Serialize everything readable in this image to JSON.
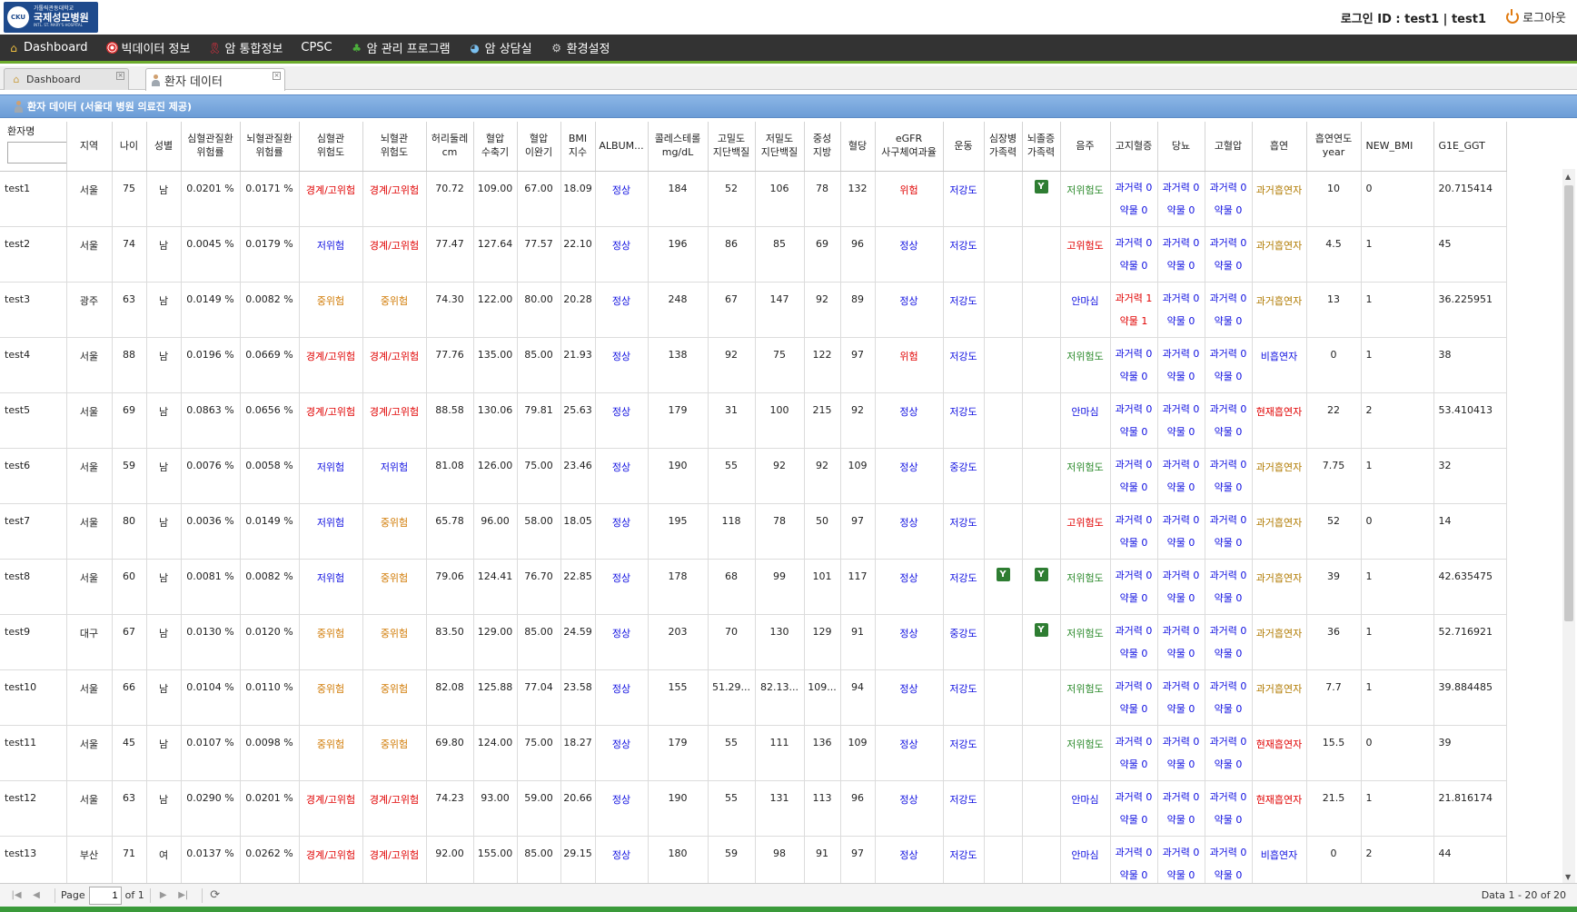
{
  "header": {
    "logo_sub": "가톨릭관동대학교",
    "logo_main": "국제성모병원",
    "logo_en": "INTL. ST. MARY'S HOSPITAL",
    "logo_emblem": "CKU",
    "login_text": "로그인 ID : test1 | test1",
    "logout_label": "로그아웃"
  },
  "menu": [
    {
      "label": "Dashboard",
      "icon": "home-icon"
    },
    {
      "label": "빅데이터 정보",
      "icon": "target-icon"
    },
    {
      "label": "암 통합정보",
      "icon": "ribbon-icon"
    },
    {
      "label": "CPSC",
      "icon": ""
    },
    {
      "label": "암 관리 프로그램",
      "icon": "plant-icon"
    },
    {
      "label": "암 상담실",
      "icon": "chat-icon"
    },
    {
      "label": "환경설정",
      "icon": "gear-icon"
    }
  ],
  "tabs": [
    {
      "label": "Dashboard"
    },
    {
      "label": "환자 데이터"
    }
  ],
  "panel_title": "환자 데이터 (서울대 병원 의료진 제공)",
  "colors": {
    "accent_green": "#6cab2c",
    "header_blue": "#6b9cd6",
    "red": "#e00000",
    "blue": "#1010e0",
    "orange": "#d07800",
    "green": "#2b8a2b"
  },
  "columns": [
    "환자명",
    "지역",
    "나이",
    "성별",
    "심혈관질환\n위험률",
    "뇌혈관질환\n위험률",
    "심혈관\n위험도",
    "뇌혈관\n위험도",
    "허리둘레\ncm",
    "혈압\n수축기",
    "혈압\n이완기",
    "BMI\n지수",
    "ALBUM...",
    "콜레스테롤\nmg/dL",
    "고밀도\n지단백질",
    "저밀도\n지단백질",
    "중성\n지방",
    "혈당",
    "eGFR\n사구체여과율",
    "운동",
    "심장병\n가족력",
    "뇌졸증\n가족력",
    "음주",
    "고지혈증",
    "당뇨",
    "고혈압",
    "흡연",
    "흡연연도\nyear",
    "NEW_BMI",
    "G1E_GGT"
  ],
  "rows": [
    {
      "name": "test1",
      "region": "서울",
      "age": "75",
      "sex": "남",
      "cvd": "0.0201 %",
      "cbd": "0.0171 %",
      "cvd_lvl": "경계/고위험",
      "cbd_lvl": "경계/고위험",
      "waist": "70.72",
      "sbp": "109.00",
      "dbp": "67.00",
      "bmi": "18.09",
      "album": "정상",
      "chol": "184",
      "hdl": "52",
      "ldl": "106",
      "tg": "78",
      "glu": "132",
      "egfr": "위험",
      "ex": "저강도",
      "heart_fh": "",
      "stroke_fh": "Y",
      "alc": "저위험도",
      "lip1": "과거력 0",
      "lip2": "약물 0",
      "dm1": "과거력 0",
      "dm2": "약물 0",
      "ht1": "과거력 0",
      "ht2": "약물 0",
      "smk": "과거흡연자",
      "smk_yr": "10",
      "new_bmi": "0",
      "ggt": "20.715414"
    },
    {
      "name": "test2",
      "region": "서울",
      "age": "74",
      "sex": "남",
      "cvd": "0.0045 %",
      "cbd": "0.0179 %",
      "cvd_lvl": "저위험",
      "cbd_lvl": "경계/고위험",
      "waist": "77.47",
      "sbp": "127.64",
      "dbp": "77.57",
      "bmi": "22.10",
      "album": "정상",
      "chol": "196",
      "hdl": "86",
      "ldl": "85",
      "tg": "69",
      "glu": "96",
      "egfr": "정상",
      "ex": "저강도",
      "heart_fh": "",
      "stroke_fh": "",
      "alc": "고위험도",
      "lip1": "과거력 0",
      "lip2": "약물 0",
      "dm1": "과거력 0",
      "dm2": "약물 0",
      "ht1": "과거력 0",
      "ht2": "약물 0",
      "smk": "과거흡연자",
      "smk_yr": "4.5",
      "new_bmi": "1",
      "ggt": "45"
    },
    {
      "name": "test3",
      "region": "광주",
      "age": "63",
      "sex": "남",
      "cvd": "0.0149 %",
      "cbd": "0.0082 %",
      "cvd_lvl": "중위험",
      "cbd_lvl": "중위험",
      "waist": "74.30",
      "sbp": "122.00",
      "dbp": "80.00",
      "bmi": "20.28",
      "album": "정상",
      "chol": "248",
      "hdl": "67",
      "ldl": "147",
      "tg": "92",
      "glu": "89",
      "egfr": "정상",
      "ex": "저강도",
      "heart_fh": "",
      "stroke_fh": "",
      "alc": "안마심",
      "lip1": "과거력 1",
      "lip2": "약물 1",
      "dm1": "과거력 0",
      "dm2": "약물 0",
      "ht1": "과거력 0",
      "ht2": "약물 0",
      "smk": "과거흡연자",
      "smk_yr": "13",
      "new_bmi": "1",
      "ggt": "36.225951"
    },
    {
      "name": "test4",
      "region": "서울",
      "age": "88",
      "sex": "남",
      "cvd": "0.0196 %",
      "cbd": "0.0669 %",
      "cvd_lvl": "경계/고위험",
      "cbd_lvl": "경계/고위험",
      "waist": "77.76",
      "sbp": "135.00",
      "dbp": "85.00",
      "bmi": "21.93",
      "album": "정상",
      "chol": "138",
      "hdl": "92",
      "ldl": "75",
      "tg": "122",
      "glu": "97",
      "egfr": "위험",
      "ex": "저강도",
      "heart_fh": "",
      "stroke_fh": "",
      "alc": "저위험도",
      "lip1": "과거력 0",
      "lip2": "약물 0",
      "dm1": "과거력 0",
      "dm2": "약물 0",
      "ht1": "과거력 0",
      "ht2": "약물 0",
      "smk": "비흡연자",
      "smk_yr": "0",
      "new_bmi": "1",
      "ggt": "38"
    },
    {
      "name": "test5",
      "region": "서울",
      "age": "69",
      "sex": "남",
      "cvd": "0.0863 %",
      "cbd": "0.0656 %",
      "cvd_lvl": "경계/고위험",
      "cbd_lvl": "경계/고위험",
      "waist": "88.58",
      "sbp": "130.06",
      "dbp": "79.81",
      "bmi": "25.63",
      "album": "정상",
      "chol": "179",
      "hdl": "31",
      "ldl": "100",
      "tg": "215",
      "glu": "92",
      "egfr": "정상",
      "ex": "저강도",
      "heart_fh": "",
      "stroke_fh": "",
      "alc": "안마심",
      "lip1": "과거력 0",
      "lip2": "약물 0",
      "dm1": "과거력 0",
      "dm2": "약물 0",
      "ht1": "과거력 0",
      "ht2": "약물 0",
      "smk": "현재흡연자",
      "smk_yr": "22",
      "new_bmi": "2",
      "ggt": "53.410413"
    },
    {
      "name": "test6",
      "region": "서울",
      "age": "59",
      "sex": "남",
      "cvd": "0.0076 %",
      "cbd": "0.0058 %",
      "cvd_lvl": "저위험",
      "cbd_lvl": "저위험",
      "waist": "81.08",
      "sbp": "126.00",
      "dbp": "75.00",
      "bmi": "23.46",
      "album": "정상",
      "chol": "190",
      "hdl": "55",
      "ldl": "92",
      "tg": "92",
      "glu": "109",
      "egfr": "정상",
      "ex": "중강도",
      "heart_fh": "",
      "stroke_fh": "",
      "alc": "저위험도",
      "lip1": "과거력 0",
      "lip2": "약물 0",
      "dm1": "과거력 0",
      "dm2": "약물 0",
      "ht1": "과거력 0",
      "ht2": "약물 0",
      "smk": "과거흡연자",
      "smk_yr": "7.75",
      "new_bmi": "1",
      "ggt": "32"
    },
    {
      "name": "test7",
      "region": "서울",
      "age": "80",
      "sex": "남",
      "cvd": "0.0036 %",
      "cbd": "0.0149 %",
      "cvd_lvl": "저위험",
      "cbd_lvl": "중위험",
      "waist": "65.78",
      "sbp": "96.00",
      "dbp": "58.00",
      "bmi": "18.05",
      "album": "정상",
      "chol": "195",
      "hdl": "118",
      "ldl": "78",
      "tg": "50",
      "glu": "97",
      "egfr": "정상",
      "ex": "저강도",
      "heart_fh": "",
      "stroke_fh": "",
      "alc": "고위험도",
      "lip1": "과거력 0",
      "lip2": "약물 0",
      "dm1": "과거력 0",
      "dm2": "약물 0",
      "ht1": "과거력 0",
      "ht2": "약물 0",
      "smk": "과거흡연자",
      "smk_yr": "52",
      "new_bmi": "0",
      "ggt": "14"
    },
    {
      "name": "test8",
      "region": "서울",
      "age": "60",
      "sex": "남",
      "cvd": "0.0081 %",
      "cbd": "0.0082 %",
      "cvd_lvl": "저위험",
      "cbd_lvl": "중위험",
      "waist": "79.06",
      "sbp": "124.41",
      "dbp": "76.70",
      "bmi": "22.85",
      "album": "정상",
      "chol": "178",
      "hdl": "68",
      "ldl": "99",
      "tg": "101",
      "glu": "117",
      "egfr": "정상",
      "ex": "저강도",
      "heart_fh": "Y",
      "stroke_fh": "Y",
      "alc": "저위험도",
      "lip1": "과거력 0",
      "lip2": "약물 0",
      "dm1": "과거력 0",
      "dm2": "약물 0",
      "ht1": "과거력 0",
      "ht2": "약물 0",
      "smk": "과거흡연자",
      "smk_yr": "39",
      "new_bmi": "1",
      "ggt": "42.635475"
    },
    {
      "name": "test9",
      "region": "대구",
      "age": "67",
      "sex": "남",
      "cvd": "0.0130 %",
      "cbd": "0.0120 %",
      "cvd_lvl": "중위험",
      "cbd_lvl": "중위험",
      "waist": "83.50",
      "sbp": "129.00",
      "dbp": "85.00",
      "bmi": "24.59",
      "album": "정상",
      "chol": "203",
      "hdl": "70",
      "ldl": "130",
      "tg": "129",
      "glu": "91",
      "egfr": "정상",
      "ex": "중강도",
      "heart_fh": "",
      "stroke_fh": "Y",
      "alc": "저위험도",
      "lip1": "과거력 0",
      "lip2": "약물 0",
      "dm1": "과거력 0",
      "dm2": "약물 0",
      "ht1": "과거력 0",
      "ht2": "약물 0",
      "smk": "과거흡연자",
      "smk_yr": "36",
      "new_bmi": "1",
      "ggt": "52.716921"
    },
    {
      "name": "test10",
      "region": "서울",
      "age": "66",
      "sex": "남",
      "cvd": "0.0104 %",
      "cbd": "0.0110 %",
      "cvd_lvl": "중위험",
      "cbd_lvl": "중위험",
      "waist": "82.08",
      "sbp": "125.88",
      "dbp": "77.04",
      "bmi": "23.58",
      "album": "정상",
      "chol": "155",
      "hdl": "51.29...",
      "ldl": "82.13...",
      "tg": "109...",
      "glu": "94",
      "egfr": "정상",
      "ex": "저강도",
      "heart_fh": "",
      "stroke_fh": "",
      "alc": "저위험도",
      "lip1": "과거력 0",
      "lip2": "약물 0",
      "dm1": "과거력 0",
      "dm2": "약물 0",
      "ht1": "과거력 0",
      "ht2": "약물 0",
      "smk": "과거흡연자",
      "smk_yr": "7.7",
      "new_bmi": "1",
      "ggt": "39.884485"
    },
    {
      "name": "test11",
      "region": "서울",
      "age": "45",
      "sex": "남",
      "cvd": "0.0107 %",
      "cbd": "0.0098 %",
      "cvd_lvl": "중위험",
      "cbd_lvl": "중위험",
      "waist": "69.80",
      "sbp": "124.00",
      "dbp": "75.00",
      "bmi": "18.27",
      "album": "정상",
      "chol": "179",
      "hdl": "55",
      "ldl": "111",
      "tg": "136",
      "glu": "109",
      "egfr": "정상",
      "ex": "저강도",
      "heart_fh": "",
      "stroke_fh": "",
      "alc": "저위험도",
      "lip1": "과거력 0",
      "lip2": "약물 0",
      "dm1": "과거력 0",
      "dm2": "약물 0",
      "ht1": "과거력 0",
      "ht2": "약물 0",
      "smk": "현재흡연자",
      "smk_yr": "15.5",
      "new_bmi": "0",
      "ggt": "39"
    },
    {
      "name": "test12",
      "region": "서울",
      "age": "63",
      "sex": "남",
      "cvd": "0.0290 %",
      "cbd": "0.0201 %",
      "cvd_lvl": "경계/고위험",
      "cbd_lvl": "경계/고위험",
      "waist": "74.23",
      "sbp": "93.00",
      "dbp": "59.00",
      "bmi": "20.66",
      "album": "정상",
      "chol": "190",
      "hdl": "55",
      "ldl": "131",
      "tg": "113",
      "glu": "96",
      "egfr": "정상",
      "ex": "저강도",
      "heart_fh": "",
      "stroke_fh": "",
      "alc": "안마심",
      "lip1": "과거력 0",
      "lip2": "약물 0",
      "dm1": "과거력 0",
      "dm2": "약물 0",
      "ht1": "과거력 0",
      "ht2": "약물 0",
      "smk": "현재흡연자",
      "smk_yr": "21.5",
      "new_bmi": "1",
      "ggt": "21.816174"
    },
    {
      "name": "test13",
      "region": "부산",
      "age": "71",
      "sex": "여",
      "cvd": "0.0137 %",
      "cbd": "0.0262 %",
      "cvd_lvl": "경계/고위험",
      "cbd_lvl": "경계/고위험",
      "waist": "92.00",
      "sbp": "155.00",
      "dbp": "85.00",
      "bmi": "29.15",
      "album": "정상",
      "chol": "180",
      "hdl": "59",
      "ldl": "98",
      "tg": "91",
      "glu": "97",
      "egfr": "정상",
      "ex": "저강도",
      "heart_fh": "",
      "stroke_fh": "",
      "alc": "안마심",
      "lip1": "과거력 0",
      "lip2": "약물 0",
      "dm1": "과거력 0",
      "dm2": "약물 0",
      "ht1": "과거력 0",
      "ht2": "약물 0",
      "smk": "비흡연자",
      "smk_yr": "0",
      "new_bmi": "2",
      "ggt": "44"
    }
  ],
  "pager": {
    "page_label": "Page",
    "page_value": "1",
    "of_label": "of 1",
    "info": "Data 1 - 20 of 20"
  }
}
